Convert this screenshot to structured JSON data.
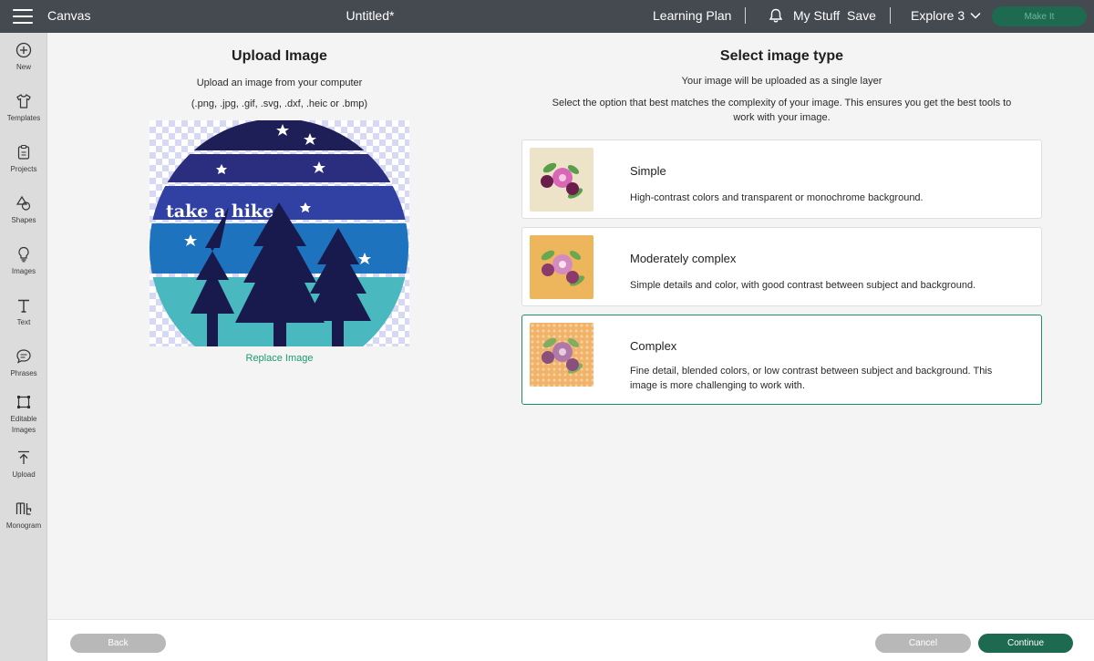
{
  "topbar": {
    "brand": "Canvas",
    "doc_title": "Untitled*",
    "learning_plan": "Learning Plan",
    "my_stuff": "My Stuff",
    "save": "Save",
    "machine": "Explore 3",
    "make_it": "Make It"
  },
  "sidebar": {
    "items": [
      {
        "label": "New",
        "icon": "plus-circle-icon"
      },
      {
        "label": "Templates",
        "icon": "shirt-icon"
      },
      {
        "label": "Projects",
        "icon": "clipboard-icon"
      },
      {
        "label": "Shapes",
        "icon": "shapes-icon"
      },
      {
        "label": "Images",
        "icon": "lightbulb-icon"
      },
      {
        "label": "Text",
        "icon": "text-icon"
      },
      {
        "label": "Phrases",
        "icon": "speech-bubble-icon"
      },
      {
        "label": "Editable",
        "label2": "Images",
        "icon": "crop-icon"
      },
      {
        "label": "Upload",
        "icon": "upload-icon"
      },
      {
        "label": "Monogram",
        "icon": "monogram-icon"
      }
    ]
  },
  "upload": {
    "title": "Upload Image",
    "line1": "Upload an image from your computer",
    "line2": "(.png, .jpg, .gif, .svg, .dxf, .heic or .bmp)",
    "preview_text": "take a hike",
    "replace": "Replace Image"
  },
  "select": {
    "title": "Select image type",
    "line1": "Your image will be uploaded as a single layer",
    "line2": "Select the option that best matches the complexity of your image. This ensures you get the best tools to",
    "line3": "work with your image.",
    "options": [
      {
        "title": "Simple",
        "desc": "High-contrast colors and transparent or monochrome background."
      },
      {
        "title": "Moderately complex",
        "desc": "Simple details and color, with good contrast between subject and background."
      },
      {
        "title": "Complex",
        "desc1": "Fine detail, blended colors, or low contrast between subject and background. This",
        "desc2": "image is more challenging to work with."
      }
    ]
  },
  "footer": {
    "back": "Back",
    "cancel": "Cancel",
    "continue": "Continue"
  },
  "colors": {
    "topbar": "#454a50",
    "accent": "#1d6a50",
    "link": "#1e9a6e"
  }
}
